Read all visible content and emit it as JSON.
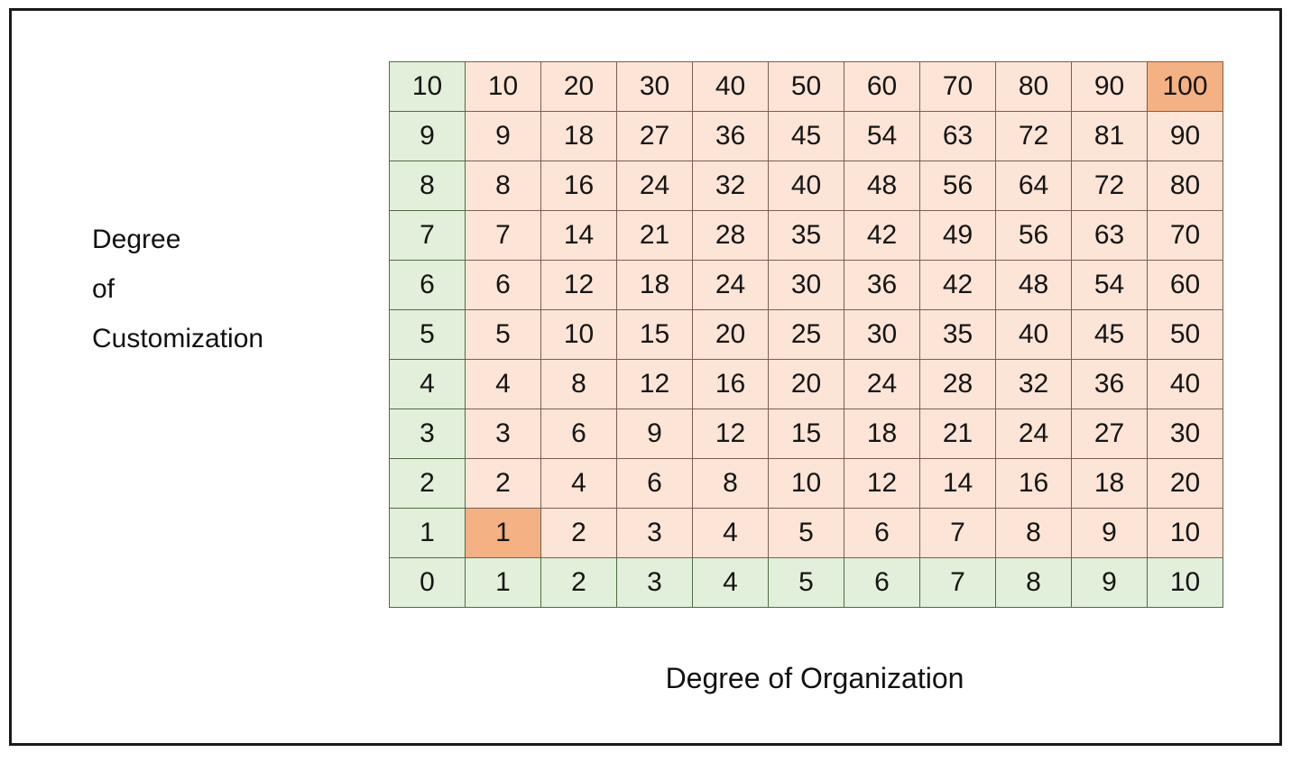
{
  "labels": {
    "y_axis_lines": [
      "Degree",
      "of",
      "Customization"
    ],
    "x_axis": "Degree of Organization"
  },
  "colors": {
    "axis_cell": "#e2efda",
    "body_cell": "#fce4d6",
    "highlight_cell": "#f4b183",
    "page_border": "#1a1a1a",
    "text": "#151515",
    "background": "#ffffff"
  },
  "chart_data": {
    "type": "heatmap",
    "title": "",
    "xlabel": "Degree of Organization",
    "ylabel": "Degree of Customization",
    "x": [
      0,
      1,
      2,
      3,
      4,
      5,
      6,
      7,
      8,
      9,
      10
    ],
    "y": [
      10,
      9,
      8,
      7,
      6,
      5,
      4,
      3,
      2,
      1,
      0
    ],
    "note": "Cell value = Degree of Organization x Degree of Customization (multiplication table). Row and column headers shown in green; product body cells in peach; the two extreme product cells (1x1=1 and 10x10=100) are highlighted in darker orange.",
    "rows": [
      {
        "header": "10",
        "values": [
          "10",
          "20",
          "30",
          "40",
          "50",
          "60",
          "70",
          "80",
          "90",
          "100"
        ]
      },
      {
        "header": "9",
        "values": [
          "9",
          "18",
          "27",
          "36",
          "45",
          "54",
          "63",
          "72",
          "81",
          "90"
        ]
      },
      {
        "header": "8",
        "values": [
          "8",
          "16",
          "24",
          "32",
          "40",
          "48",
          "56",
          "64",
          "72",
          "80"
        ]
      },
      {
        "header": "7",
        "values": [
          "7",
          "14",
          "21",
          "28",
          "35",
          "42",
          "49",
          "56",
          "63",
          "70"
        ]
      },
      {
        "header": "6",
        "values": [
          "6",
          "12",
          "18",
          "24",
          "30",
          "36",
          "42",
          "48",
          "54",
          "60"
        ]
      },
      {
        "header": "5",
        "values": [
          "5",
          "10",
          "15",
          "20",
          "25",
          "30",
          "35",
          "40",
          "45",
          "50"
        ]
      },
      {
        "header": "4",
        "values": [
          "4",
          "8",
          "12",
          "16",
          "20",
          "24",
          "28",
          "32",
          "36",
          "40"
        ]
      },
      {
        "header": "3",
        "values": [
          "3",
          "6",
          "9",
          "12",
          "15",
          "18",
          "21",
          "24",
          "27",
          "30"
        ]
      },
      {
        "header": "2",
        "values": [
          "2",
          "4",
          "6",
          "8",
          "10",
          "12",
          "14",
          "16",
          "18",
          "20"
        ]
      },
      {
        "header": "1",
        "values": [
          "1",
          "2",
          "3",
          "4",
          "5",
          "6",
          "7",
          "8",
          "9",
          "10"
        ]
      }
    ],
    "bottom_row": {
      "header": "0",
      "values": [
        "1",
        "2",
        "3",
        "4",
        "5",
        "6",
        "7",
        "8",
        "9",
        "10"
      ]
    },
    "highlighted_cells": [
      {
        "row": "10",
        "col": "10",
        "value": "100"
      },
      {
        "row": "1",
        "col": "1",
        "value": "1"
      }
    ]
  }
}
